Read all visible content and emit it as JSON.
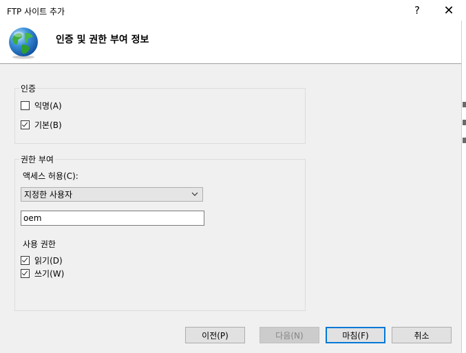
{
  "window": {
    "title": "FTP 사이트 추가",
    "help": "?",
    "close": "✕"
  },
  "header": {
    "title": "인증 및 권한 부여 정보"
  },
  "authentication": {
    "legend": "인증",
    "anonymous": {
      "label": "익명(A)",
      "checked": false
    },
    "basic": {
      "label": "기본(B)",
      "checked": true
    }
  },
  "authorization": {
    "legend": "권한 부여",
    "access_label": "액세스 허용(C):",
    "access_select": {
      "value": "지정한 사용자"
    },
    "users_input": {
      "value": "oem"
    },
    "permissions_label": "사용 권한",
    "read": {
      "label": "읽기(D)",
      "checked": true
    },
    "write": {
      "label": "쓰기(W)",
      "checked": true
    }
  },
  "buttons": {
    "previous": "이전(P)",
    "next": "다음(N)",
    "finish": "마침(F)",
    "cancel": "취소"
  },
  "icons": {
    "header_icon": "globe-icon",
    "dropdown": "chevron-down-icon"
  },
  "colors": {
    "accent": "#0078d7",
    "dialog_bg": "#f0f0f0"
  }
}
